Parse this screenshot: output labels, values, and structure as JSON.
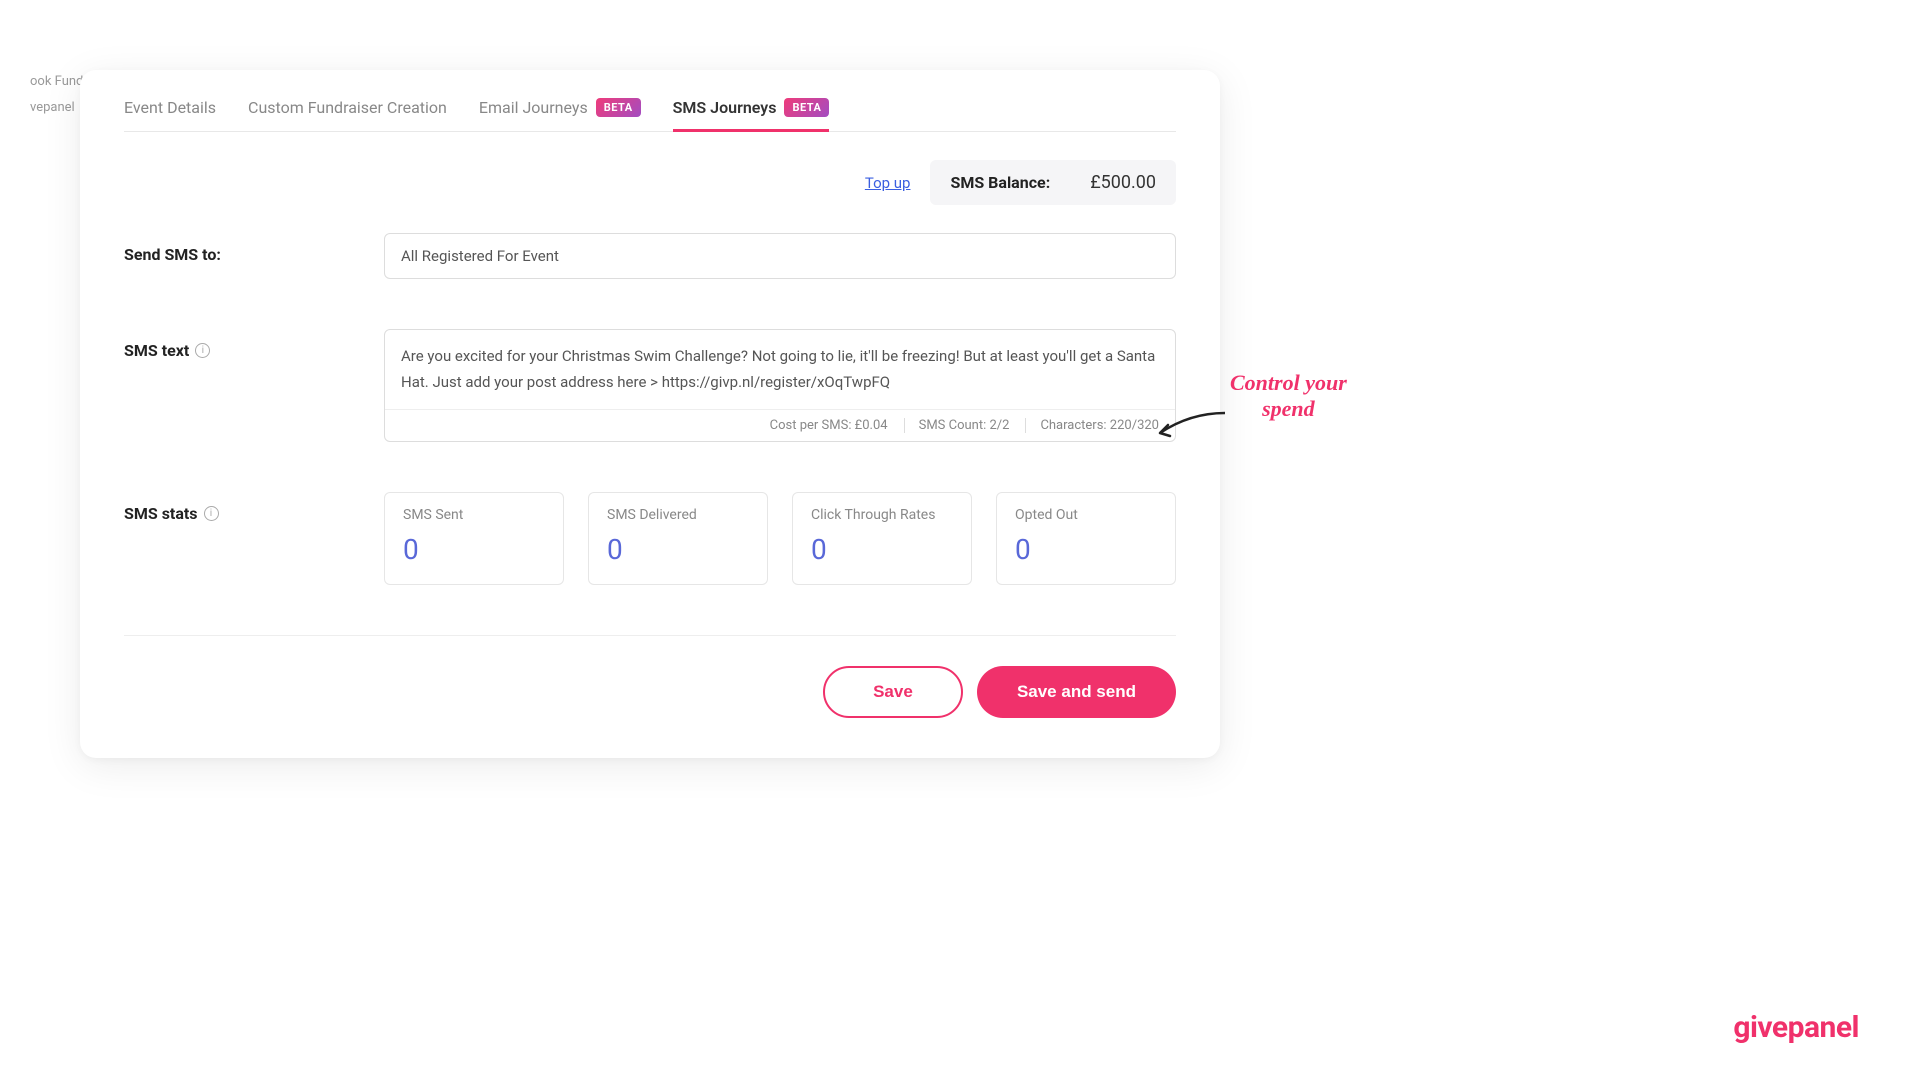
{
  "background": {
    "text1": "ook Fund",
    "text2": "vepanel"
  },
  "tabs": {
    "event_details": "Event Details",
    "custom_fundraiser": "Custom Fundraiser Creation",
    "email_journeys": "Email Journeys",
    "email_beta": "BETA",
    "sms_journeys": "SMS Journeys",
    "sms_beta": "BETA"
  },
  "balance": {
    "topup": "Top up",
    "label": "SMS Balance:",
    "value": "£500.00"
  },
  "form": {
    "send_to_label": "Send SMS to:",
    "send_to_value": "All Registered For Event",
    "sms_text_label": "SMS text",
    "sms_text_value": "Are you excited for your Christmas Swim Challenge? Not going to lie, it'll be freezing! But at least you'll get a Santa Hat. Just add your post address here > https://givp.nl/register/xOqTwpFQ",
    "cost_per_sms": "Cost per SMS: £0.04",
    "sms_count": "SMS Count: 2/2",
    "characters": "Characters:  220/320"
  },
  "stats": {
    "label": "SMS stats",
    "cards": [
      {
        "label": "SMS Sent",
        "value": "0"
      },
      {
        "label": "SMS Delivered",
        "value": "0"
      },
      {
        "label": "Click Through Rates",
        "value": "0"
      },
      {
        "label": "Opted Out",
        "value": "0"
      }
    ]
  },
  "actions": {
    "save": "Save",
    "save_and_send": "Save and send"
  },
  "annotation": {
    "line1": "Control your",
    "line2": "spend"
  },
  "brand": "givepanel"
}
